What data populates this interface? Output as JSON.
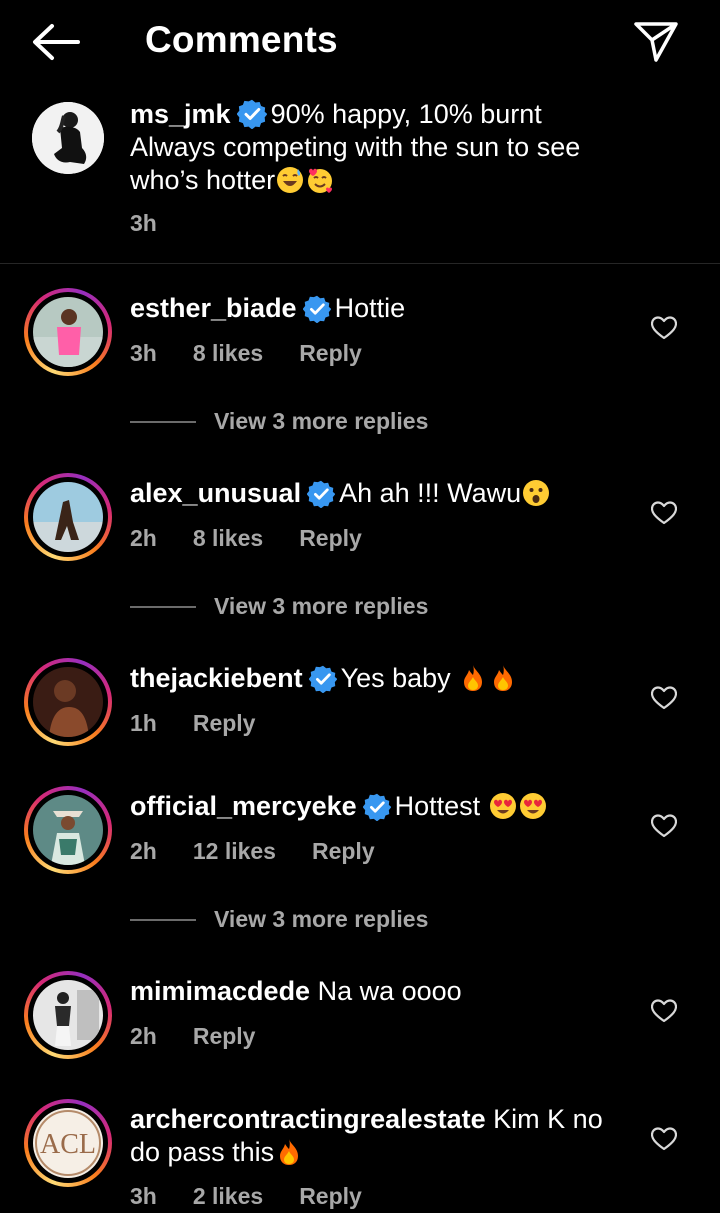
{
  "header": {
    "title": "Comments",
    "back_icon": "arrow-left-icon",
    "share_icon": "paper-plane-icon"
  },
  "caption": {
    "username": "ms_jmk",
    "line1": "90% happy, 10% burnt",
    "line2": "Always competing with the sun to see",
    "line3": "who’s hotter",
    "time": "3h"
  },
  "comments": [
    {
      "username": "esther_biade",
      "text": "Hottie",
      "time": "3h",
      "likes": "8 likes",
      "reply": "Reply",
      "more": "View 3 more replies"
    },
    {
      "username": "alex_unusual",
      "text": "Ah ah !!! Wawu",
      "time": "2h",
      "likes": "8 likes",
      "reply": "Reply",
      "more": "View 3 more replies"
    },
    {
      "username": "thejackiebent",
      "text": "Yes baby",
      "time": "1h",
      "likes": "",
      "reply": "Reply"
    },
    {
      "username": "official_mercyeke",
      "text": "Hottest",
      "time": "2h",
      "likes": "12 likes",
      "reply": "Reply",
      "more": "View 3 more replies"
    },
    {
      "username": "mimimacdede",
      "text": "Na wa oooo",
      "time": "2h",
      "likes": "",
      "reply": "Reply"
    },
    {
      "username": "archercontractingrealestate",
      "text": "Kim K no",
      "text2": "do pass this",
      "time": "3h",
      "likes": "2 likes",
      "reply": "Reply",
      "logo_text": "ACL"
    }
  ],
  "colors": {
    "verified": "#3897f0",
    "secondary_text": "#a8a8a8",
    "background": "#000000"
  }
}
